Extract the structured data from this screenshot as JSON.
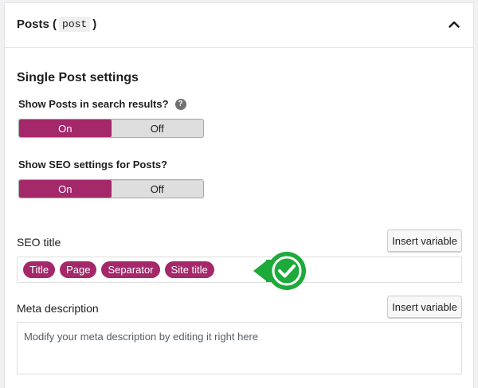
{
  "panel": {
    "title_prefix": "Posts (",
    "title_code": "post",
    "title_suffix": ")"
  },
  "section": {
    "title": "Single Post settings"
  },
  "search_results": {
    "label": "Show Posts in search results?",
    "help": "?",
    "options": [
      "On",
      "Off"
    ],
    "selected": "On"
  },
  "seo_settings": {
    "label": "Show SEO settings for Posts?",
    "options": [
      "On",
      "Off"
    ],
    "selected": "On"
  },
  "seo_title": {
    "label": "SEO title",
    "insert_label": "Insert variable",
    "chips": [
      "Title",
      "Page",
      "Separator",
      "Site title"
    ]
  },
  "meta_description": {
    "label": "Meta description",
    "insert_label": "Insert variable",
    "placeholder": "Modify your meta description by editing it right here"
  },
  "colors": {
    "accent": "#a4286a",
    "success": "#1eaa3a"
  }
}
